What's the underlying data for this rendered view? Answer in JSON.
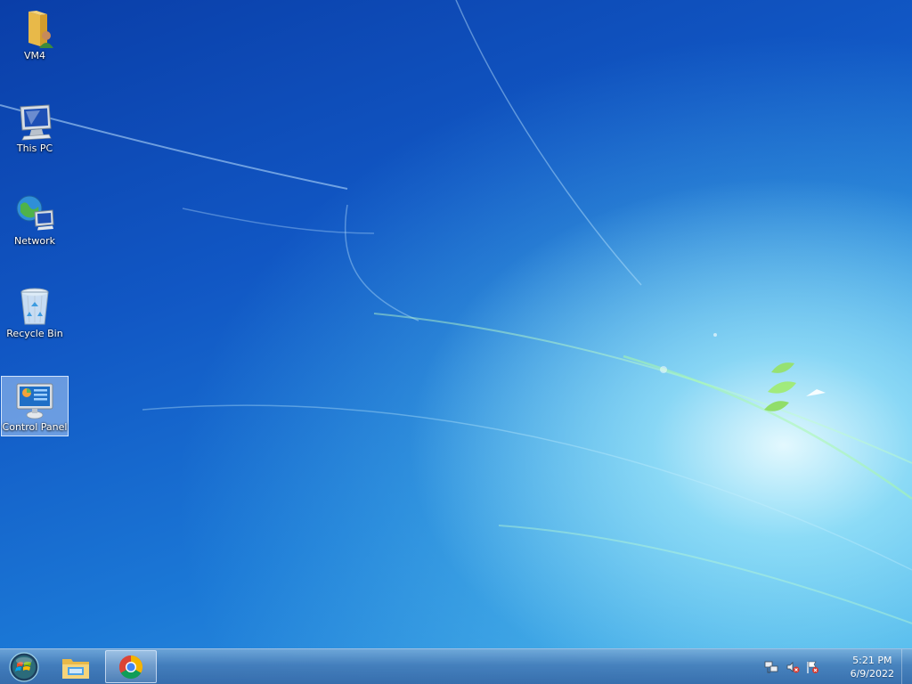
{
  "desktop": {
    "icons": [
      {
        "label": "VM4",
        "icon": "user-folder-icon"
      },
      {
        "label": "This PC",
        "icon": "computer-icon"
      },
      {
        "label": "Network",
        "icon": "network-globe-icon"
      },
      {
        "label": "Recycle Bin",
        "icon": "recycle-bin-icon"
      },
      {
        "label": "Control Panel",
        "icon": "control-panel-icon",
        "selected": true
      }
    ]
  },
  "taskbar": {
    "start": {
      "icon": "start-orb-icon"
    },
    "pinned": [
      {
        "icon": "file-explorer-icon"
      },
      {
        "icon": "chrome-icon",
        "active": true
      }
    ],
    "tray": {
      "icons": [
        "network-disconnected-icon",
        "volume-muted-icon",
        "action-center-flag-icon"
      ],
      "time": "5:21 PM",
      "date": "6/9/2022"
    }
  },
  "colors": {
    "desktop_dark": "#0a3ea8",
    "desktop_light": "#3aa3e6",
    "taskbar": "#466fb0",
    "label_text": "#ffffff"
  }
}
